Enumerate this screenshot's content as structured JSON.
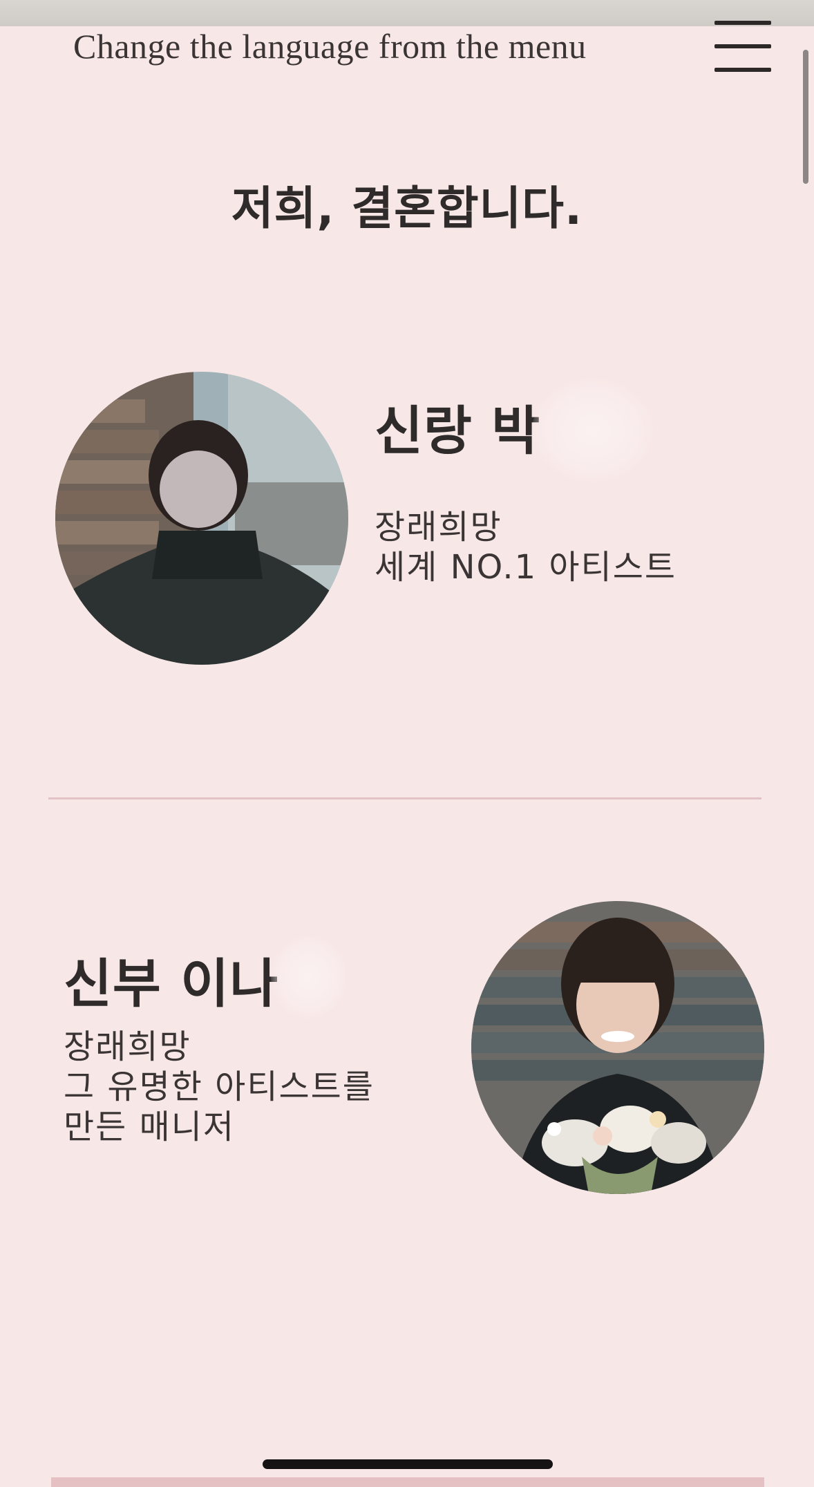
{
  "header": {
    "language_note": "Change the language from the menu",
    "menu_icon": "hamburger-menu-icon"
  },
  "headline": "저희, 결혼합니다.",
  "groom": {
    "name": "신랑 박",
    "desc_line1": "장래희망",
    "desc_line2": "세계 NO.1 아티스트",
    "photo": "groom-photo"
  },
  "bride": {
    "name": "신부 이나",
    "desc_line1": "장래희망",
    "desc_line2": "그 유명한 아티스트를",
    "desc_line3": "만든 매니저",
    "photo": "bride-photo"
  },
  "colors": {
    "background": "#f7e8e7",
    "divider": "#e2c2c5",
    "text": "#2f2b2b",
    "accent_bar": "#e6c1c3"
  }
}
